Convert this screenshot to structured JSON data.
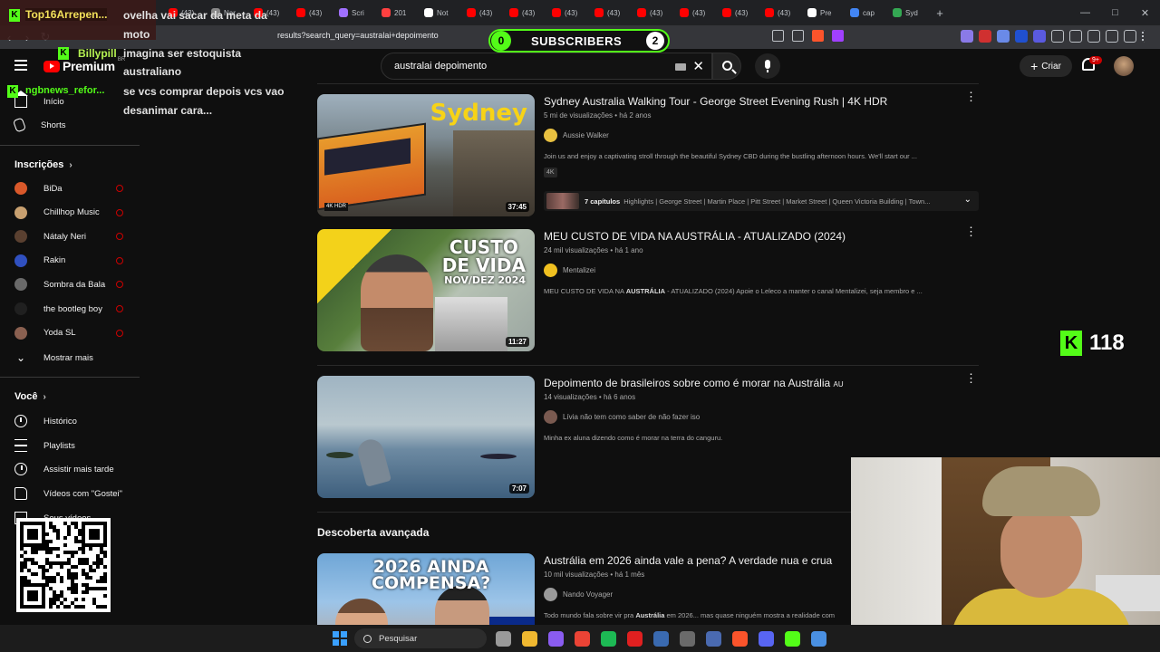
{
  "browser": {
    "tabs": [
      {
        "label": "(43)",
        "color": "#ff0000"
      },
      {
        "label": "Nar",
        "color": "#888888"
      },
      {
        "label": "(43)",
        "color": "#ff0000"
      },
      {
        "label": "(43)",
        "color": "#ff0000"
      },
      {
        "label": "Scri",
        "color": "#a070ff"
      },
      {
        "label": "201",
        "color": "#ff4040"
      },
      {
        "label": "Not",
        "color": "#ffffff"
      },
      {
        "label": "(43)",
        "color": "#ff0000"
      },
      {
        "label": "(43)",
        "color": "#ff0000"
      },
      {
        "label": "(43)",
        "color": "#ff0000"
      },
      {
        "label": "(43)",
        "color": "#ff0000"
      },
      {
        "label": "(43)",
        "color": "#ff0000"
      },
      {
        "label": "(43)",
        "color": "#ff0000"
      },
      {
        "label": "(43)",
        "color": "#ff0000"
      },
      {
        "label": "(43)",
        "color": "#ff0000"
      },
      {
        "label": "Pre",
        "color": "#ffffff"
      },
      {
        "label": "cap",
        "color": "#4285f4"
      },
      {
        "label": "Syd",
        "color": "#34a853"
      }
    ],
    "new_tab": "+",
    "url": "results?search_query=australai+depoimento"
  },
  "youtube": {
    "logo_word": "Premium",
    "logo_region": "BR",
    "search_query": "australai depoimento",
    "create_label": "Criar",
    "notif_count": "9+"
  },
  "sidebar": {
    "home": "Início",
    "shorts": "Shorts",
    "subs_title": "Inscrições",
    "channels": [
      {
        "name": "BiDa",
        "color": "#d9582a"
      },
      {
        "name": "Chillhop Music",
        "color": "#c8a070"
      },
      {
        "name": "Nátaly Neri",
        "color": "#5a4030"
      },
      {
        "name": "Rakin",
        "color": "#3050c0"
      },
      {
        "name": "Sombra da Bala",
        "color": "#6a6a6a"
      },
      {
        "name": "the bootleg boy",
        "color": "#202020"
      },
      {
        "name": "Yoda SL",
        "color": "#8a6050"
      }
    ],
    "show_more": "Mostrar mais",
    "you_title": "Você",
    "history": "Histórico",
    "playlists": "Playlists",
    "watch_later": "Assistir mais tarde",
    "liked": "Vídeos com \"Gostei\"",
    "your_videos": "Seus vídeos"
  },
  "results": [
    {
      "title": "Sydney Australia Walking Tour - George Street Evening Rush | 4K HDR",
      "views": "5 mi de visualizações",
      "age": "há 2 anos",
      "channel": "Aussie Walker",
      "channel_color": "#e8c040",
      "desc": "Join us and enjoy a captivating stroll through the beautiful Sydney CBD during the bustling afternoon hours. We'll start our ...",
      "badge": "4K",
      "duration": "37:45",
      "thumb_text": "Sydney",
      "thumb_badge": "4K HDR",
      "chapters_label": "7 capítulos",
      "chapters_text": "Highlights | George Street | Martin Place | Pitt Street | Market Street | Queen Victoria Building | Town..."
    },
    {
      "title": "MEU CUSTO DE VIDA NA AUSTRÁLIA - ATUALIZADO (2024)",
      "views": "24 mil visualizações",
      "age": "há 1 ano",
      "channel": "Mentalizei",
      "channel_color": "#f0c020",
      "desc_pre": "MEU CUSTO DE VIDA NA ",
      "desc_bold": "AUSTRÁLIA",
      "desc_post": " - ATUALIZADO (2024) Apoie o Leleco a manter o canal Mentalizei, seja membro e ...",
      "duration": "11:27",
      "thumb_line1": "CUSTO",
      "thumb_line2": "DE VIDA",
      "thumb_line3": "NOV/DEZ 2024"
    },
    {
      "title": "Depoimento de brasileiros sobre como é morar na Austrália",
      "title_suffix": "AU",
      "views": "14 visualizações",
      "age": "há 6 anos",
      "channel": "Lívia não tem como saber de não fazer iso",
      "channel_color": "#7a5a50",
      "desc": "Minha ex aluna dizendo como é morar na terra do canguru.",
      "duration": "7:07"
    },
    {
      "title": "Austrália em 2026 ainda vale a pena? A verdade nua e crua",
      "views": "10 mil visualizações",
      "age": "há 1 mês",
      "channel": "Nando Voyager",
      "channel_color": "#9a9a9a",
      "desc_pre": "Todo mundo fala sobre vir pra ",
      "desc_bold": "Austrália",
      "desc_post": " em 2026... mas quase ninguém mostra a realidade com",
      "thumb_line1": "2026 AINDA",
      "thumb_line2": "COMPENSA?"
    }
  ],
  "section_advanced": "Descoberta avançada",
  "overlay": {
    "chat": [
      {
        "user": "Top16Arrepen...",
        "msg": "ovelha vai sacar da meta da"
      },
      {
        "user": "",
        "msg": "moto"
      },
      {
        "user": "Billypill",
        "msg": "imagina ser estoquista"
      },
      {
        "user": "",
        "msg": "australiano"
      },
      {
        "user": "ngbnews_refor...",
        "msg": "se vcs comprar depois vcs vao"
      },
      {
        "user": "",
        "msg": "desanimar cara..."
      }
    ],
    "sub_count": "0",
    "sub_label": "SUBSCRIBERS",
    "sub_goal": "2",
    "viewer_count": "118"
  },
  "taskbar": {
    "search_label": "Pesquisar",
    "icons": [
      "#9a9a9a",
      "#f0b830",
      "#8a5cf0",
      "#ea4335",
      "#1db954",
      "#e02020",
      "#3a6ab0",
      "#6a6a6a",
      "#4a6ab0",
      "#fb542b",
      "#5865f2",
      "#53fc18",
      "#4a90e2"
    ]
  }
}
